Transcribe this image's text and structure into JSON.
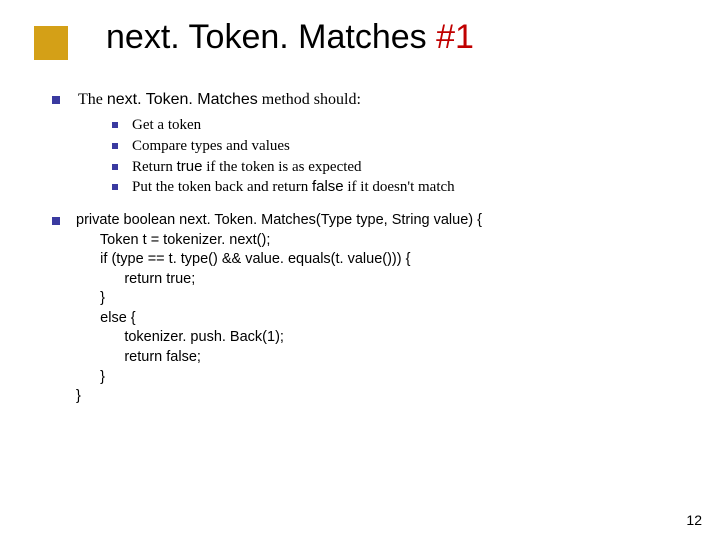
{
  "title": {
    "text": "next. Token. Matches ",
    "hash": "#1"
  },
  "intro": {
    "prefix": "The ",
    "code": "next. Token. Matches",
    "suffix": " method should:"
  },
  "sub_bullets": [
    {
      "text": "Get a token"
    },
    {
      "prefix": "Compare types and values"
    },
    {
      "prefix": "Return ",
      "code": "true",
      "suffix": " if the token is as expected"
    },
    {
      "prefix": "Put the token back and return ",
      "code": "false",
      "suffix": " if it doesn't match"
    }
  ],
  "code_lines": [
    "private boolean next. Token. Matches(Type type, String value) {",
    "      Token t = tokenizer. next();",
    "      if (type == t. type() && value. equals(t. value())) {",
    "            return true;",
    "      }",
    "      else {",
    "            tokenizer. push. Back(1);",
    "            return false;",
    "      }",
    "}"
  ],
  "page_number": "12"
}
